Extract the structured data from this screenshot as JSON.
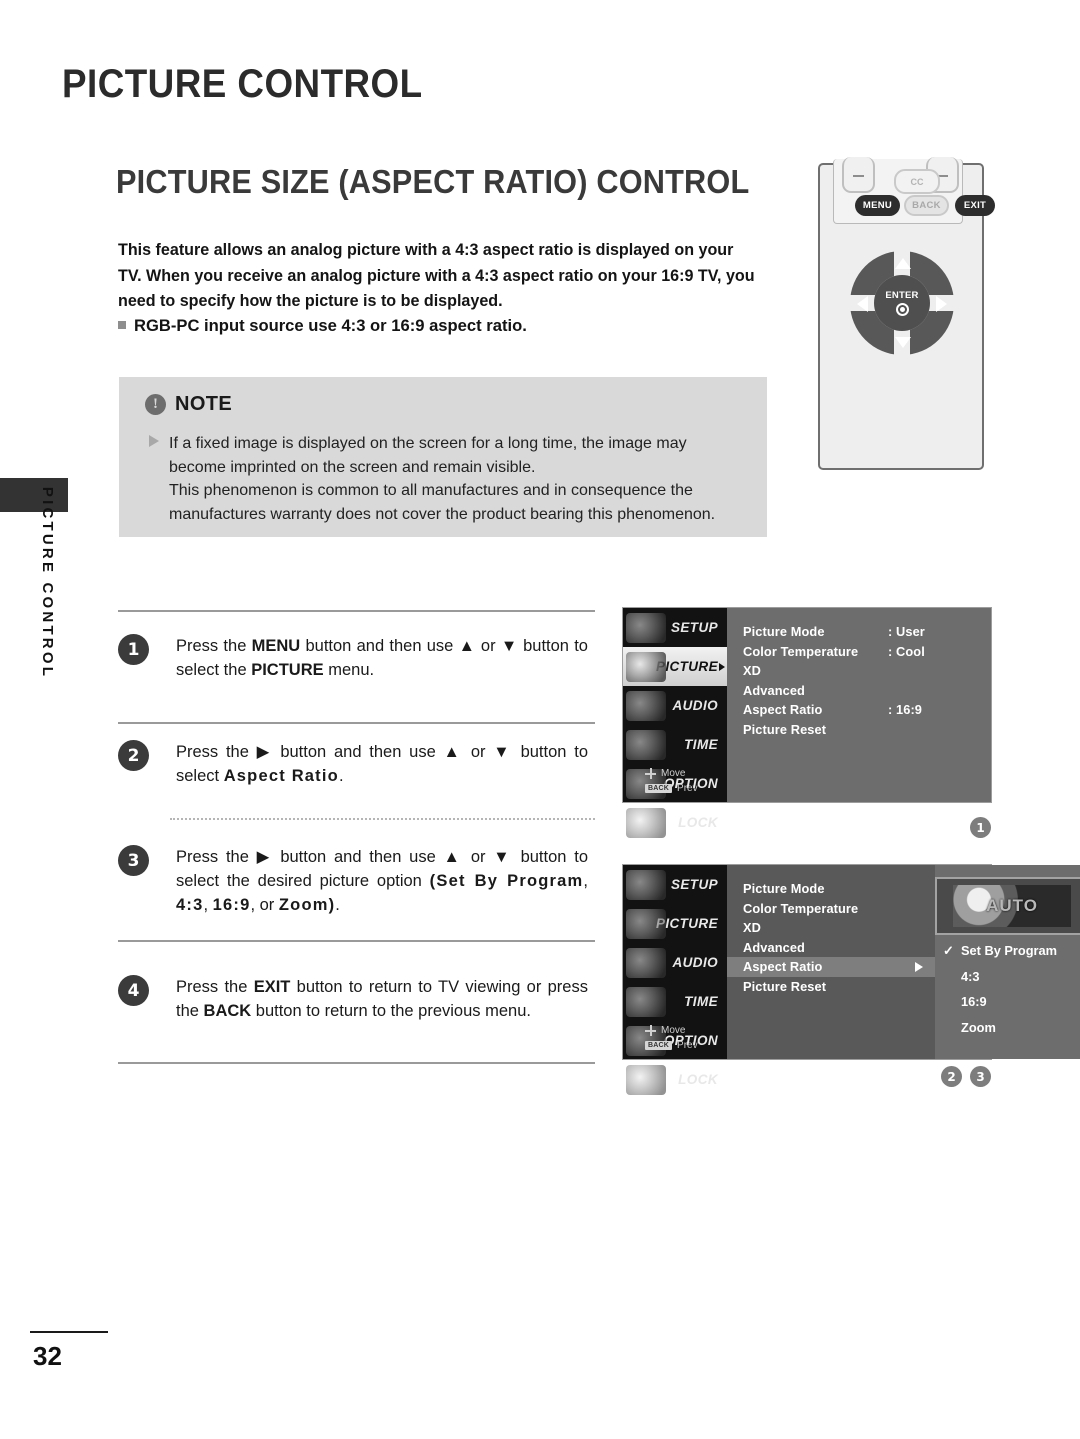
{
  "page": {
    "header_title": "PICTURE CONTROL",
    "section_title": "PICTURE SIZE (ASPECT RATIO) CONTROL",
    "side_tab_label": "PICTURE CONTROL",
    "page_number": "32"
  },
  "intro": {
    "paragraph": "This feature allows an analog picture with a 4:3 aspect ratio is displayed on your TV. When you receive an analog picture with a 4:3 aspect ratio on your 16:9 TV, you need to specify how the picture is to be displayed.",
    "bullet": "RGB-PC input source use 4:3 or 16:9 aspect ratio."
  },
  "note": {
    "title": "NOTE",
    "icon": "exclamation-icon",
    "bullet_icon": "triangle-right-icon",
    "line1": "If a fixed image is displayed on the screen for a long time, the image may become imprinted on the screen and remain visible.",
    "line2": "This phenomenon is common to all manufactures and in consequence the manufactures warranty does not cover the product bearing this phenomenon."
  },
  "remote": {
    "cc_label": "CC",
    "menu_label": "MENU",
    "back_label": "BACK",
    "exit_label": "EXIT",
    "enter_label": "ENTER"
  },
  "steps": [
    {
      "num": "1",
      "parts": [
        {
          "t": "Press the ",
          "s": "n"
        },
        {
          "t": "MENU",
          "s": "b"
        },
        {
          "t": " button and then use ",
          "s": "n"
        },
        {
          "t": "▲",
          "s": "n"
        },
        {
          "t": " or ",
          "s": "n"
        },
        {
          "t": "▼",
          "s": "n"
        },
        {
          "t": " button to select the ",
          "s": "n"
        },
        {
          "t": "PICTURE",
          "s": "b"
        },
        {
          "t": " menu.",
          "s": "n"
        }
      ]
    },
    {
      "num": "2",
      "parts": [
        {
          "t": "Press the ",
          "s": "n"
        },
        {
          "t": "▶",
          "s": "n"
        },
        {
          "t": " button and then use ",
          "s": "n"
        },
        {
          "t": "▲",
          "s": "n"
        },
        {
          "t": " or ",
          "s": "n"
        },
        {
          "t": "▼",
          "s": "n"
        },
        {
          "t": " button to select ",
          "s": "n"
        },
        {
          "t": "Aspect Ratio",
          "s": "sp"
        },
        {
          "t": ".",
          "s": "n"
        }
      ]
    },
    {
      "num": "3",
      "parts": [
        {
          "t": "Press the ",
          "s": "n"
        },
        {
          "t": "▶",
          "s": "n"
        },
        {
          "t": " button and then use ",
          "s": "n"
        },
        {
          "t": "▲",
          "s": "n"
        },
        {
          "t": " or ",
          "s": "n"
        },
        {
          "t": "▼",
          "s": "n"
        },
        {
          "t": " button to select the desired picture option ",
          "s": "n"
        },
        {
          "t": "(Set By Program",
          "s": "sp"
        },
        {
          "t": ", ",
          "s": "n"
        },
        {
          "t": "4:3",
          "s": "sp"
        },
        {
          "t": ", ",
          "s": "n"
        },
        {
          "t": "16:9",
          "s": "sp"
        },
        {
          "t": ", or ",
          "s": "n"
        },
        {
          "t": "Zoom)",
          "s": "sp"
        },
        {
          "t": ".",
          "s": "n"
        }
      ]
    },
    {
      "num": "4",
      "parts": [
        {
          "t": "Press the ",
          "s": "n"
        },
        {
          "t": "EXIT",
          "s": "b"
        },
        {
          "t": " button to return to TV viewing or press the ",
          "s": "n"
        },
        {
          "t": "BACK",
          "s": "b"
        },
        {
          "t": " button to return to the previous menu.",
          "s": "n"
        }
      ]
    }
  ],
  "osd_common": {
    "side_items": [
      "SETUP",
      "PICTURE",
      "AUDIO",
      "TIME",
      "OPTION",
      "LOCK"
    ],
    "move_label": "Move",
    "prev_label": "Prev",
    "back_chip": "BACK"
  },
  "osd1": {
    "selected_side": "PICTURE",
    "rows": [
      {
        "label": "Picture Mode",
        "value": ": User"
      },
      {
        "label": "Color Temperature",
        "value": ": Cool"
      },
      {
        "label": "XD",
        "value": ""
      },
      {
        "label": "Advanced",
        "value": ""
      },
      {
        "label": "Aspect Ratio",
        "value": ": 16:9"
      },
      {
        "label": "Picture Reset",
        "value": ""
      }
    ],
    "marker": "1"
  },
  "osd2": {
    "rows": [
      {
        "label": "Picture Mode",
        "active": false
      },
      {
        "label": "Color Temperature",
        "active": false
      },
      {
        "label": "XD",
        "active": false
      },
      {
        "label": "Advanced",
        "active": false
      },
      {
        "label": "Aspect Ratio",
        "active": true
      },
      {
        "label": "Picture Reset",
        "active": false
      }
    ],
    "preview_label": "AUTO",
    "options": [
      {
        "label": "Set By Program",
        "checked": true
      },
      {
        "label": "4:3",
        "checked": false
      },
      {
        "label": "16:9",
        "checked": false
      },
      {
        "label": "Zoom",
        "checked": false
      }
    ],
    "markers": [
      "2",
      "3"
    ]
  }
}
